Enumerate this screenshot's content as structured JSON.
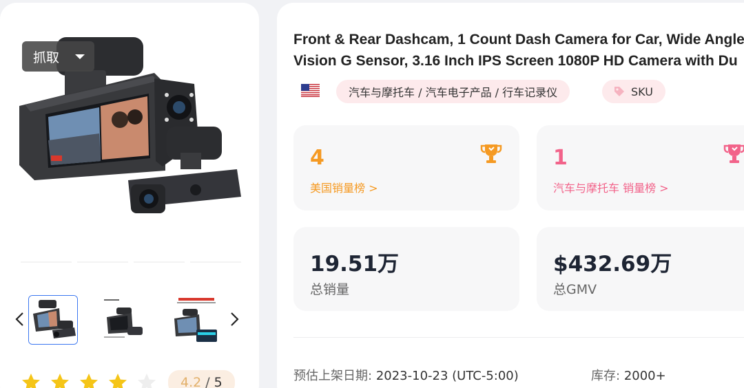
{
  "gallery": {
    "grab_button_label": "抓取",
    "thumbnail_count": 3
  },
  "rating": {
    "value": "4.2",
    "separator": "/",
    "max": "5",
    "filled_stars": 4
  },
  "product": {
    "title_line1": "Front & Rear Dashcam, 1 Count Dash Camera for Car, Wide Angle",
    "title_line2": "Vision G Sensor, 3.16 Inch IPS Screen 1080P HD Camera with Du",
    "category_path": "汽车与摩托车 / 汽车电子产品 / 行车记录仪",
    "sku_label": "SKU",
    "country_icon": "us-flag-icon"
  },
  "rankings": [
    {
      "rank": "4",
      "label": "美国销量榜 >",
      "color": "#f59a23"
    },
    {
      "rank": "1",
      "label": "汽车与摩托车 销量榜 >",
      "color": "#f2638a"
    }
  ],
  "stats": [
    {
      "value": "19.51万",
      "label": "总销量"
    },
    {
      "value": "$432.69万",
      "label": "总GMV"
    }
  ],
  "meta": {
    "date_key": "预估上架日期:",
    "date_value": "2023-10-23 (UTC-5:00)",
    "stock_key": "库存:",
    "stock_value": "2000+"
  },
  "colors": {
    "accent_orange": "#f59a23",
    "accent_pink": "#f2638a",
    "star_yellow": "#f5c518",
    "thumb_active_border": "#3a76f0"
  }
}
